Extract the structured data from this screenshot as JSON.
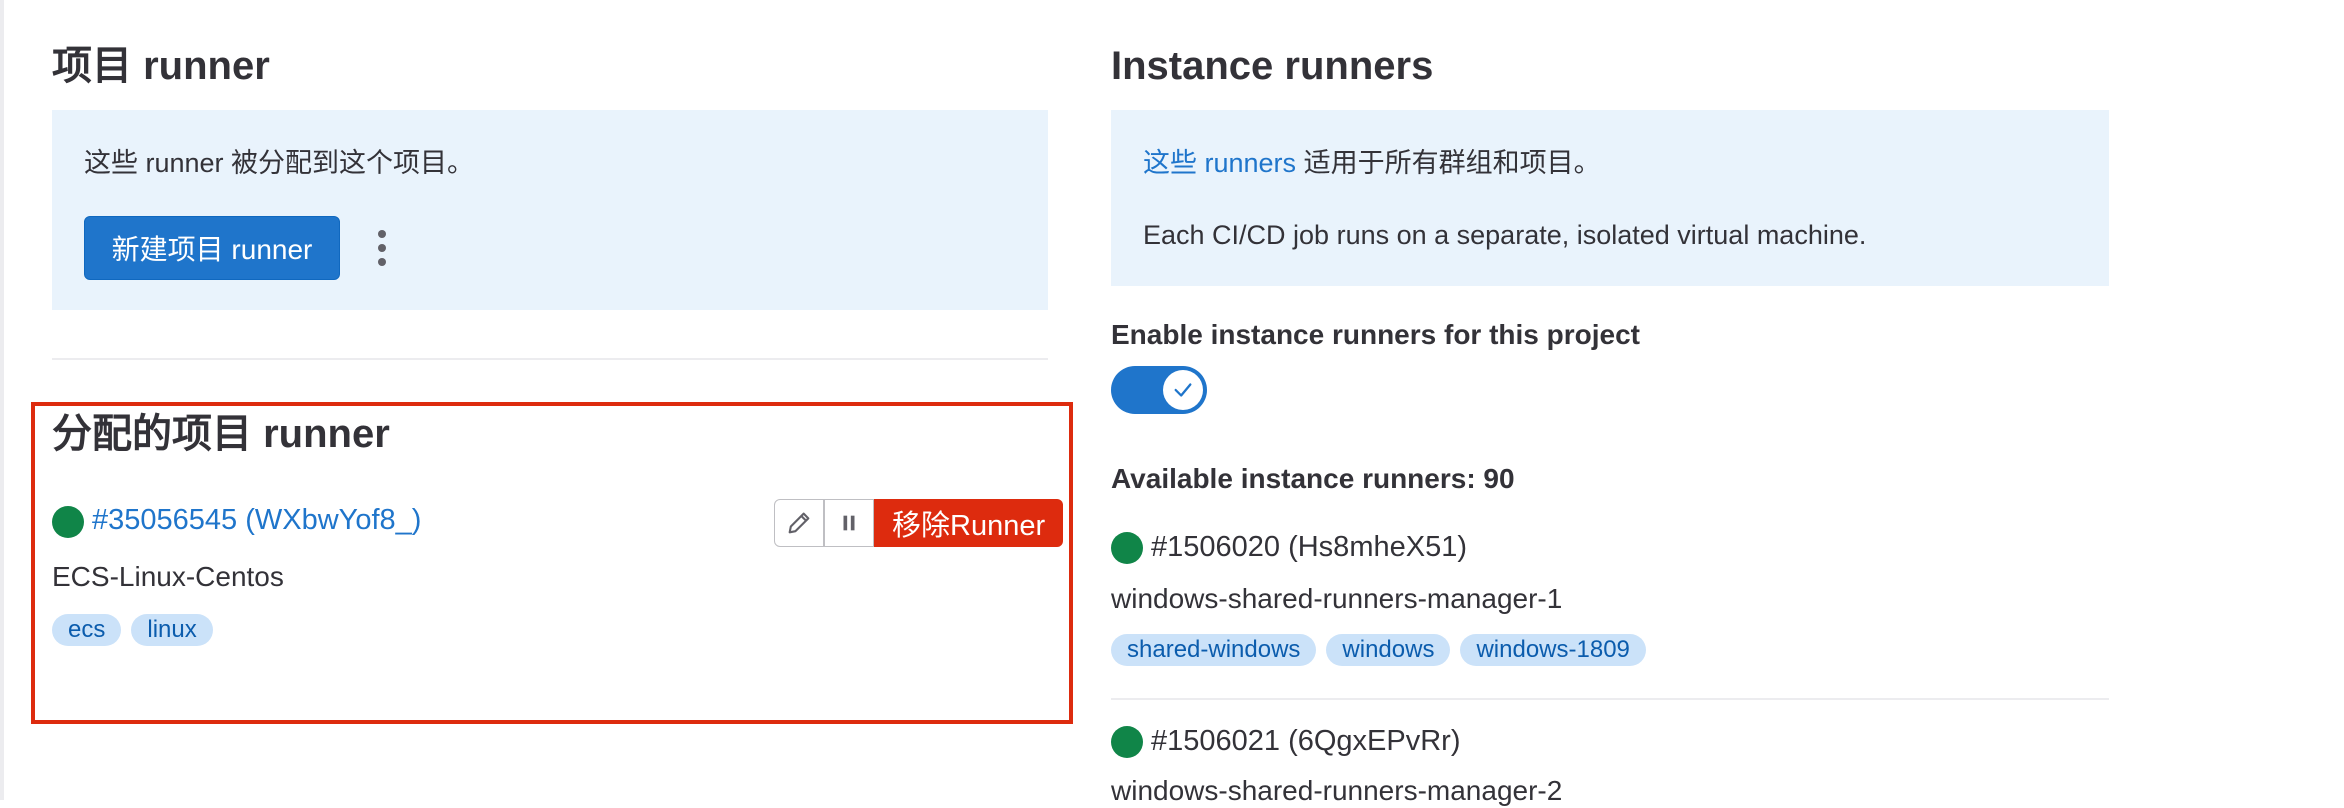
{
  "project_runners": {
    "title": "项目 runner",
    "info_text": "这些 runner 被分配到这个项目。",
    "new_button_label": "新建项目 runner",
    "more_actions_icon": "kebab-vertical-icon"
  },
  "assigned": {
    "title": "分配的项目 runner",
    "runner": {
      "id_label": "#35056545 (WXbwYof8_)",
      "description": "ECS-Linux-Centos",
      "status": "online",
      "tags": [
        "ecs",
        "linux"
      ],
      "edit_icon": "pencil-icon",
      "pause_icon": "pause-icon",
      "remove_label": "移除Runner"
    }
  },
  "instance": {
    "title": "Instance runners",
    "info_link": "这些 runners",
    "info_rest": " 适用于所有群组和项目。",
    "info_line2": "Each CI/CD job runs on a separate, isolated virtual machine.",
    "enable_label": "Enable instance runners for this project",
    "toggle_on": true,
    "available_label": "Available instance runners: 90",
    "runners": [
      {
        "id_label": "#1506020 (Hs8mheX51)",
        "description": "windows-shared-runners-manager-1",
        "tags": [
          "shared-windows",
          "windows",
          "windows-1809"
        ]
      },
      {
        "id_label": "#1506021 (6QgxEPvRr)",
        "description": "windows-shared-runners-manager-2"
      }
    ]
  },
  "colors": {
    "primary": "#1f75cb",
    "danger": "#dd2b0e",
    "success": "#108548",
    "alert_bg": "#e9f3fc",
    "tag_bg": "#cbe2f9"
  }
}
